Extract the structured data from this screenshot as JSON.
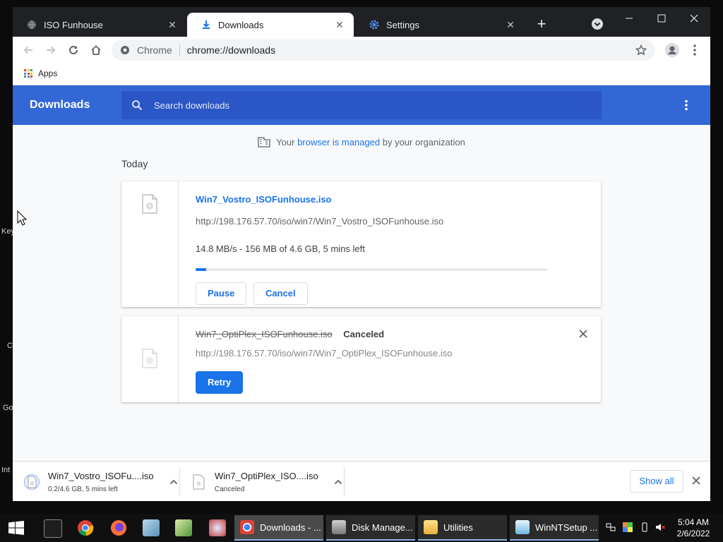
{
  "desktop": {
    "fragments": [
      "Key",
      "C",
      "Go",
      "Int"
    ]
  },
  "tabs": [
    {
      "label": "ISO Funhouse",
      "icon": "globe-icon"
    },
    {
      "label": "Downloads",
      "icon": "download-icon"
    },
    {
      "label": "Settings",
      "icon": "gear-icon"
    }
  ],
  "omnibox": {
    "scheme_label": "Chrome",
    "url": "chrome://downloads"
  },
  "bookmarks": {
    "apps_label": "Apps"
  },
  "downloads_page": {
    "title": "Downloads",
    "search_placeholder": "Search downloads",
    "managed": {
      "prefix": "Your",
      "link": "browser is managed",
      "suffix": "by your organization"
    },
    "section_today": "Today",
    "items": [
      {
        "filename": "Win7_Vostro_ISOFunhouse.iso",
        "url": "http://198.176.57.70/iso/win7/Win7_Vostro_ISOFunhouse.iso",
        "progress_text": "14.8 MB/s - 156 MB of 4.6 GB, 5 mins left",
        "progress_fraction": 0.03,
        "pause_label": "Pause",
        "cancel_label": "Cancel"
      },
      {
        "filename": "Win7_OptiPlex_ISOFunhouse.iso",
        "status": "Canceled",
        "url": "http://198.176.57.70/iso/win7/Win7_OptiPlex_ISOFunhouse.iso",
        "retry_label": "Retry"
      }
    ]
  },
  "shelf": {
    "items": [
      {
        "name": "Win7_Vostro_ISOFu....iso",
        "sub": "0.2/4.6 GB, 5 mins left"
      },
      {
        "name": "Win7_OptiPlex_ISO....iso",
        "sub": "Canceled"
      }
    ],
    "show_all_label": "Show all"
  },
  "taskbar": {
    "apps": [
      {
        "label": "Downloads - ...",
        "active": true
      },
      {
        "label": "Disk Manage...",
        "active": false
      },
      {
        "label": "Utilities",
        "active": false
      },
      {
        "label": "WinNTSetup ...",
        "active": false
      }
    ],
    "clock": {
      "time": "5:04 AM",
      "date": "2/6/2022"
    }
  },
  "colors": {
    "accent_blue": "#1a73e8",
    "header_blue": "#3367d6",
    "tabstrip": "#202124"
  }
}
